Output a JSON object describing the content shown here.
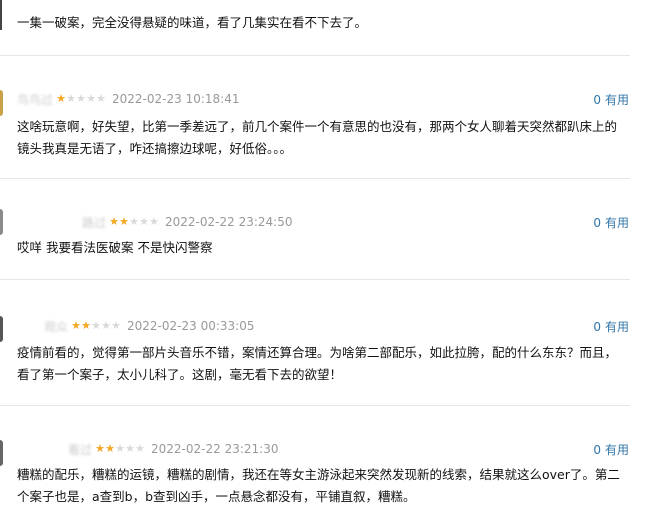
{
  "top_fragment": {
    "text": "一集一破案，完全没得悬疑的味道，看了几集实在看不下去了。"
  },
  "comments": [
    {
      "username": "鸟鸟过",
      "rating": 1,
      "time": "2022-02-23 10:18:41",
      "votes": "0",
      "vote_label": "有用",
      "content": "这啥玩意啊，好失望，比第一季差远了，前几个案件一个有意思的也没有，那两个女人聊着天突然都趴床上的镜头我真是无语了，咋还搞擦边球呢，好低俗。。。"
    },
    {
      "username": "路过",
      "rating": 2,
      "time": "2022-02-22 23:24:50",
      "votes": "0",
      "vote_label": "有用",
      "content": "哎咩 我要看法医破案 不是快闪警察"
    },
    {
      "username": "观众",
      "rating": 2,
      "time": "2022-02-23 00:33:05",
      "votes": "0",
      "vote_label": "有用",
      "content": "疫情前看的，觉得第一部片头音乐不错，案情还算合理。为啥第二部配乐，如此拉胯，配的什么东东？而且，看了第一个案子，太小儿科了。这剧，毫无看下去的欲望！"
    },
    {
      "username": "看过",
      "rating": 2,
      "time": "2022-02-22 23:21:30",
      "votes": "0",
      "vote_label": "有用",
      "content": "糟糕的配乐，糟糕的运镜，糟糕的剧情，我还在等女主游泳起来突然发现新的线索，结果就这么over了。第二个案子也是，a查到b，b查到凶手，一点悬念都没有，平铺直叙，糟糕。"
    }
  ],
  "colors": {
    "star_on": "#f5a623",
    "star_off": "#d9d9d9",
    "link": "#3377aa",
    "meta_text": "#999999"
  }
}
